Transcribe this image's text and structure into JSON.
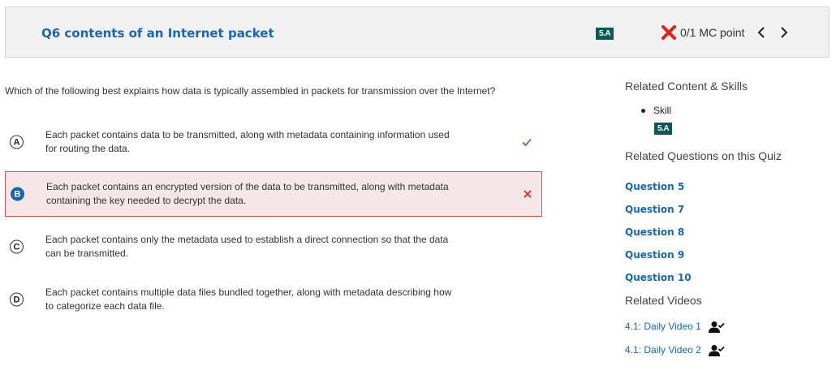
{
  "header": {
    "title": "Q6 contents of an Internet packet",
    "badge": "5.A",
    "points": "0/1 MC point",
    "icons": {
      "result": "red-x-icon",
      "prev": "chevron-left-icon",
      "next": "chevron-right-icon"
    },
    "colors": {
      "background": "#f1f1f1",
      "title": "#1866b8",
      "badge": "#0c5a58",
      "wrong": "#e0231c"
    }
  },
  "question": {
    "text": "Which of the following best explains how data is typically assembled in packets for transmission over the Internet?"
  },
  "options": [
    {
      "letter": "A",
      "text": "Each packet contains data to be transmitted, along with metadata containing information used for routing the data.",
      "status": "correct",
      "icon": "check-icon"
    },
    {
      "letter": "B",
      "text": "Each packet contains an encrypted version of the data to be transmitted, along with metadata containing the key needed to decrypt the data.",
      "status": "selected-wrong",
      "icon": "x-icon"
    },
    {
      "letter": "C",
      "text": "Each packet contains only the metadata used to establish a direct connection so that the data can be transmitted.",
      "status": "none"
    },
    {
      "letter": "D",
      "text": "Each packet contains multiple data files bundled together, along with metadata describing how to categorize each data file.",
      "status": "none"
    }
  ],
  "sidebar": {
    "related_content_heading": "Related Content & Skills",
    "skill_label": "Skill",
    "skill_badge": "5.A",
    "related_questions_heading": "Related Questions on this Quiz",
    "questions": [
      "Question 5",
      "Question 7",
      "Question 8",
      "Question 9",
      "Question 10"
    ],
    "related_videos_heading": "Related Videos",
    "videos": [
      {
        "label": "4.1: Daily Video 1",
        "icon": "person-check-icon"
      },
      {
        "label": "4.1: Daily Video 2",
        "icon": "person-check-icon"
      }
    ]
  }
}
